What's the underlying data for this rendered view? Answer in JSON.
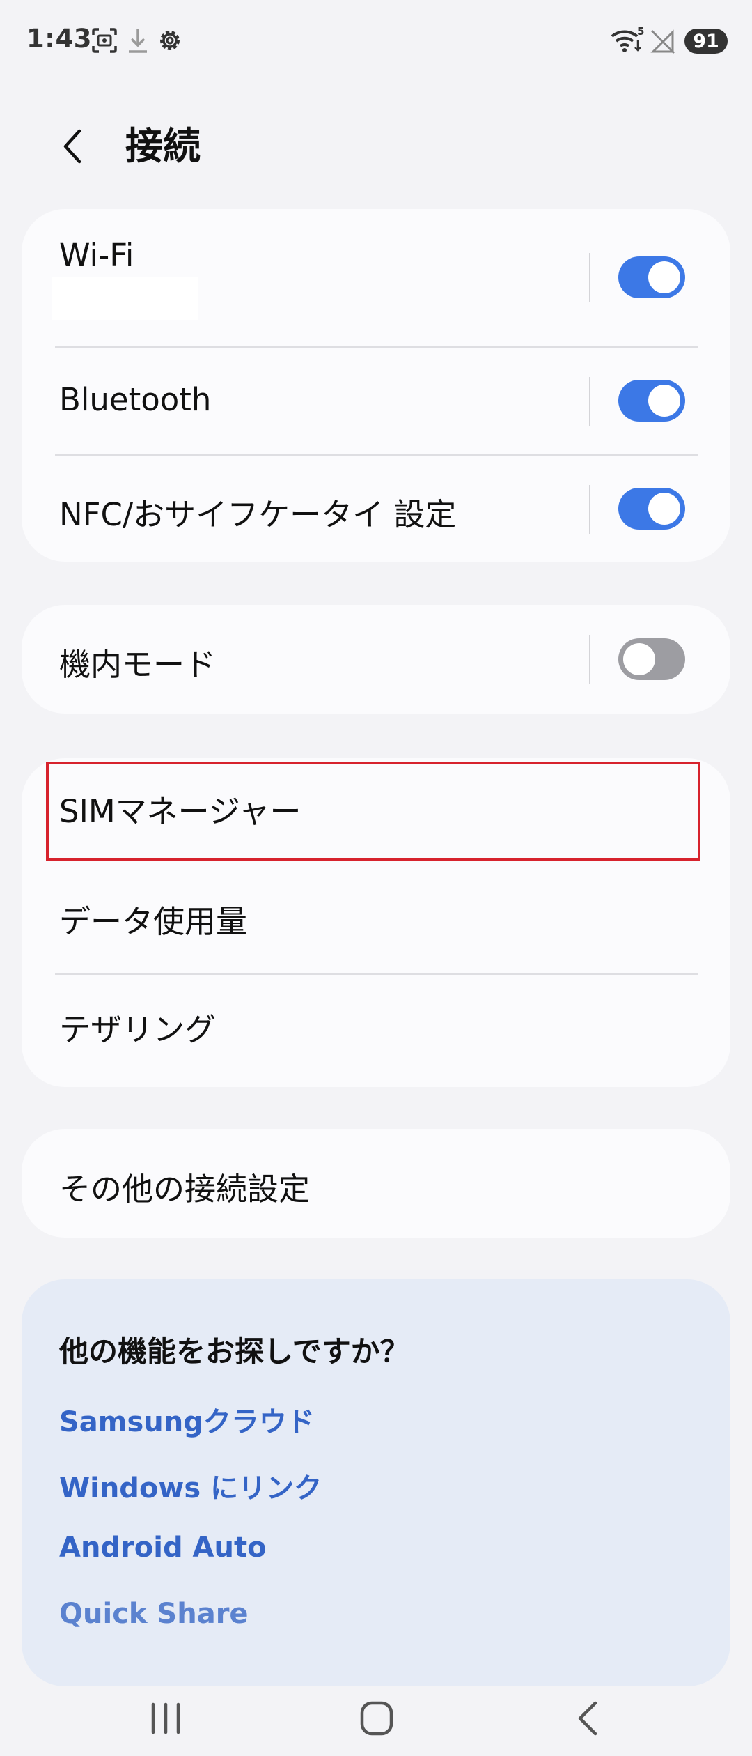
{
  "status_bar": {
    "time": "1:43",
    "battery": "91",
    "icons": [
      "screenshot-icon",
      "download-icon",
      "settings-gear-icon",
      "wifi-icon",
      "no-signal-icon",
      "battery-icon"
    ],
    "wifi_label": "5"
  },
  "header": {
    "back_icon": "back-arrow-icon",
    "title": "接続"
  },
  "group1": {
    "wifi": {
      "label": "Wi-Fi",
      "enabled": true
    },
    "bluetooth": {
      "label": "Bluetooth",
      "enabled": true
    },
    "nfc": {
      "label": "NFC/おサイフケータイ 設定",
      "enabled": true
    }
  },
  "group2": {
    "airplane": {
      "label": "機内モード",
      "enabled": false
    }
  },
  "group3": {
    "sim_manager": {
      "label": "SIMマネージャー"
    },
    "data_usage": {
      "label": "データ使用量"
    },
    "tethering": {
      "label": "テザリング"
    }
  },
  "group4": {
    "more": {
      "label": "その他の接続設定"
    }
  },
  "suggestions": {
    "title": "他の機能をお探しですか？",
    "links": [
      "Samsungクラウド",
      "Windows にリンク",
      "Android Auto",
      "Quick Share"
    ]
  },
  "nav": {
    "icons": [
      "recent-apps-icon",
      "home-icon",
      "back-icon"
    ]
  },
  "colors": {
    "accent": "#3c78e6",
    "link": "#3464c6",
    "highlight": "#d7232d",
    "background": "#f3f3f6"
  }
}
